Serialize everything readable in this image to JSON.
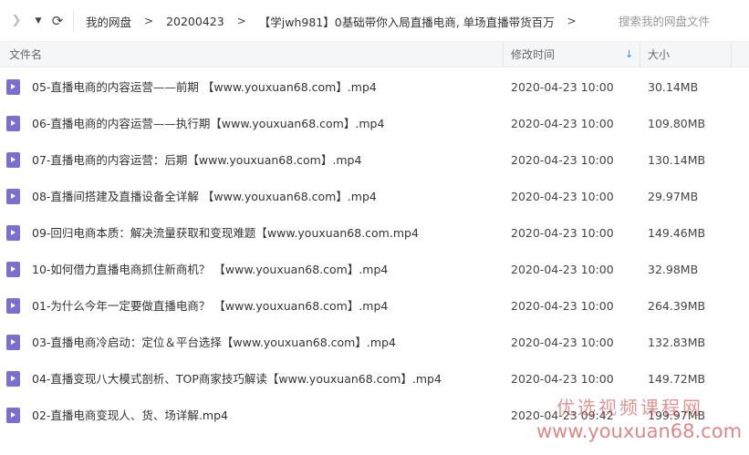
{
  "nav": {
    "back_glyph": "❯",
    "dropdown_glyph": "▼",
    "refresh_glyph": "⟳"
  },
  "breadcrumb": {
    "items": [
      "我的网盘",
      "20200423",
      "【学jwh981】0基础带你入局直播电商, 单场直播带货百万"
    ],
    "separator": ">"
  },
  "search": {
    "placeholder": "搜索我的网盘文件"
  },
  "columns": {
    "name": "文件名",
    "modified": "修改时间",
    "size": "大小",
    "sort_arrow": "↓"
  },
  "icons": {
    "file": "video-file-icon",
    "color": "#7a6fd0"
  },
  "files": [
    {
      "name": "05-直播电商的内容运营——前期 【www.youxuan68.com】.mp4",
      "modified": "2020-04-23 10:00",
      "size": "30.14MB"
    },
    {
      "name": "06-直播电商的内容运营——执行期【www.youxuan68.com】.mp4",
      "modified": "2020-04-23 10:00",
      "size": "109.80MB"
    },
    {
      "name": "07-直播电商的内容运营：后期【www.youxuan68.com】.mp4",
      "modified": "2020-04-23 10:00",
      "size": "130.14MB"
    },
    {
      "name": "08-直播间搭建及直播设备全详解 【www.youxuan68.com】.mp4",
      "modified": "2020-04-23 10:00",
      "size": "29.97MB"
    },
    {
      "name": "09-回归电商本质：解决流量获取和变现难题【www.youxuan68.com.mp4",
      "modified": "2020-04-23 10:00",
      "size": "149.46MB"
    },
    {
      "name": "10-如何借力直播电商抓住新商机？ 【www.youxuan68.com】.mp4",
      "modified": "2020-04-23 10:00",
      "size": "32.98MB"
    },
    {
      "name": "01-为什么今年一定要做直播电商？ 【www.youxuan68.com】.mp4",
      "modified": "2020-04-23 10:00",
      "size": "264.39MB"
    },
    {
      "name": "03-直播电商冷启动：定位＆平台选择【www.youxuan68.com】.mp4",
      "modified": "2020-04-23 10:00",
      "size": "132.83MB"
    },
    {
      "name": "04-直播变现八大模式剖析、TOP商家技巧解读【www.youxuan68.com】.mp4",
      "modified": "2020-04-23 10:00",
      "size": "149.72MB"
    },
    {
      "name": "02-直播电商变现人、货、场详解.mp4",
      "modified": "2020-04-23 09:42",
      "size": "199.97MB"
    }
  ],
  "watermark": {
    "chinese": "优选视频课程网",
    "url": "www.youxuan68.com"
  }
}
